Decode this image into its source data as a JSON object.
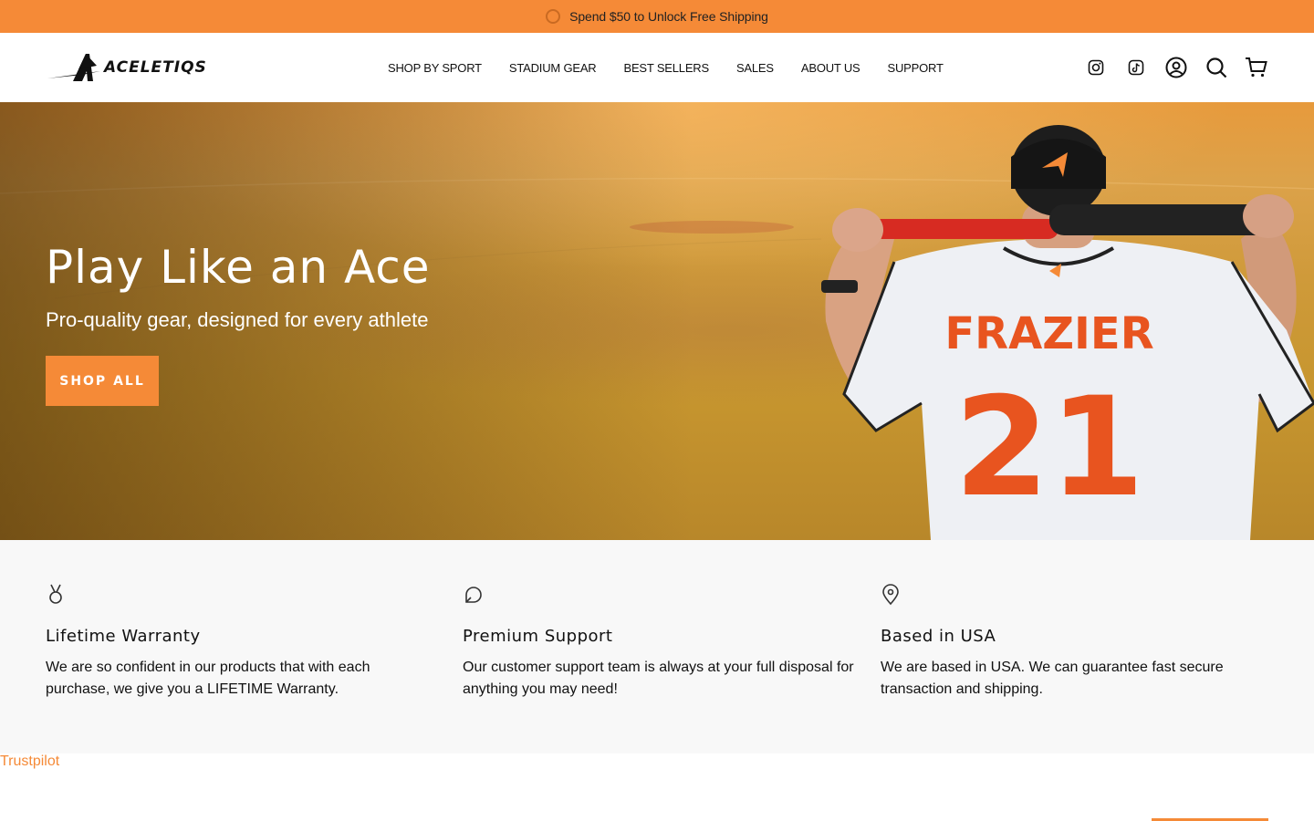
{
  "announcement": {
    "text": "Spend $50 to Unlock Free Shipping"
  },
  "header": {
    "logo_text": "ACELETIQS",
    "nav": [
      "SHOP BY SPORT",
      "STADIUM GEAR",
      "BEST SELLERS",
      "SALES",
      "ABOUT US",
      "SUPPORT"
    ],
    "icons": [
      "instagram-icon",
      "tiktok-icon",
      "account-icon",
      "search-icon",
      "cart-icon"
    ]
  },
  "hero": {
    "title": "Play Like an Ace",
    "subtitle": "Pro-quality gear, designed for every athlete",
    "button": "SHOP ALL",
    "jersey_name": "FRAZIER",
    "jersey_number": "21"
  },
  "features": [
    {
      "icon": "medal-icon",
      "title": "Lifetime Warranty",
      "text": "We are so confident in our products that with each purchase, we give you a LIFETIME Warranty."
    },
    {
      "icon": "chat-icon",
      "title": "Premium Support",
      "text": "Our customer support team is always at your full disposal for anything you may need!"
    },
    {
      "icon": "location-pin-icon",
      "title": "Based in USA",
      "text": "We are based in USA. We can guarantee fast secure transaction and shipping."
    }
  ],
  "trustpilot": "Trustpilot",
  "colors": {
    "accent": "#f58a37",
    "features_bg": "#f8f8f8"
  }
}
